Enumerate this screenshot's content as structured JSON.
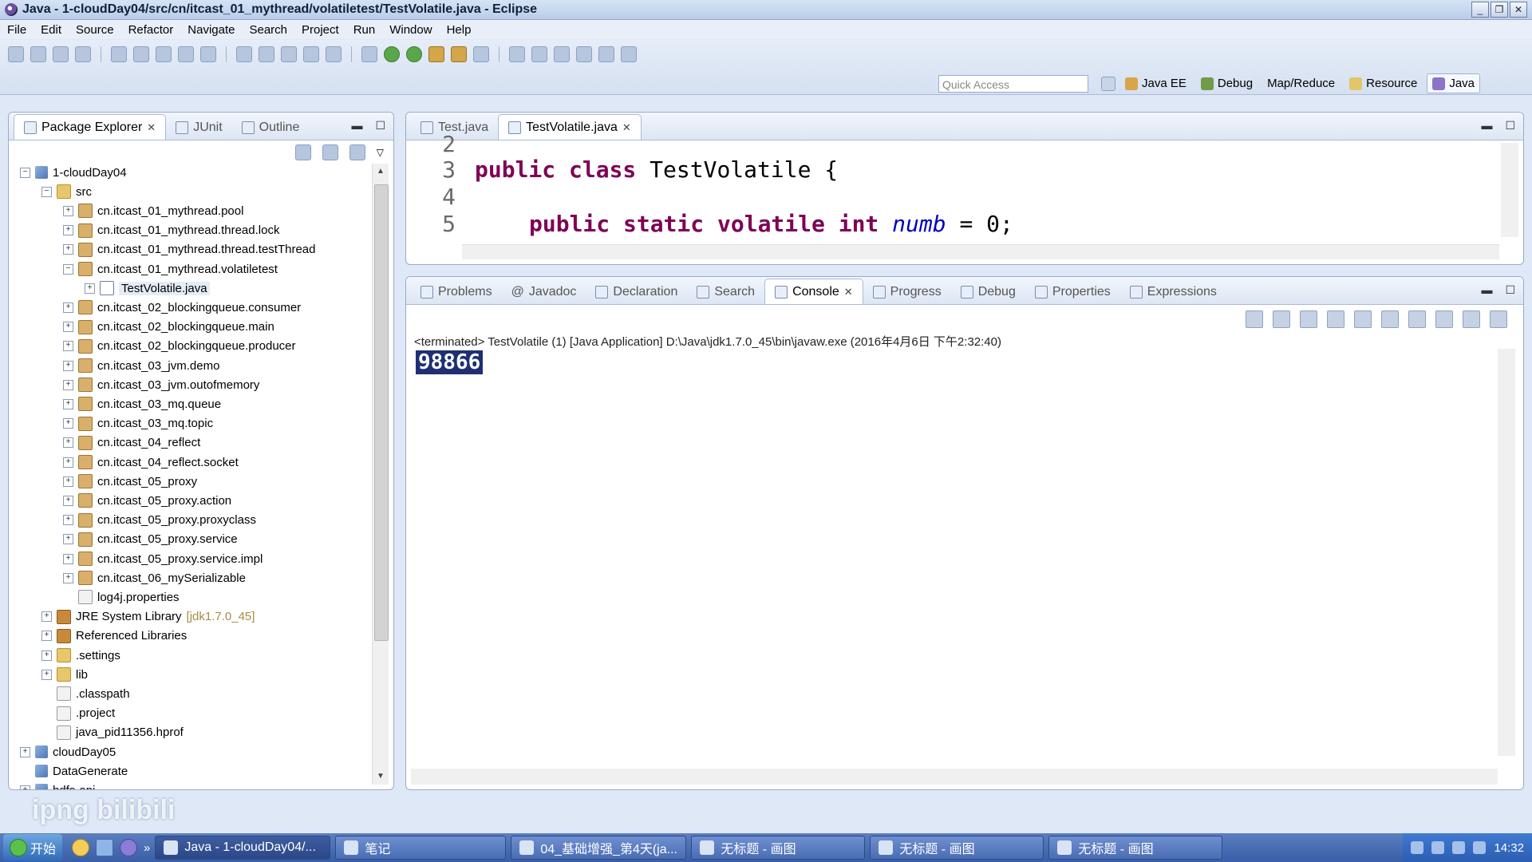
{
  "window": {
    "title": "Java - 1-cloudDay04/src/cn/itcast_01_mythread/volatiletest/TestVolatile.java - Eclipse"
  },
  "menu": [
    "File",
    "Edit",
    "Source",
    "Refactor",
    "Navigate",
    "Search",
    "Project",
    "Run",
    "Window",
    "Help"
  ],
  "quick_access": {
    "placeholder": "Quick Access"
  },
  "perspectives": [
    "Java EE",
    "Debug",
    "Map/Reduce",
    "Resource",
    "Java"
  ],
  "left_tabs": [
    {
      "label": "Package Explorer",
      "closable": true
    },
    {
      "label": "JUnit",
      "closable": false
    },
    {
      "label": "Outline",
      "closable": false
    }
  ],
  "tree": [
    {
      "label": "1-cloudDay04",
      "level": 0,
      "icon": "project-icon",
      "expand": "−"
    },
    {
      "label": "src",
      "level": 1,
      "icon": "folder-icon",
      "expand": "−"
    },
    {
      "label": "cn.itcast_01_mythread.pool",
      "level": 2,
      "icon": "package-icon",
      "expand": "+"
    },
    {
      "label": "cn.itcast_01_mythread.thread.lock",
      "level": 2,
      "icon": "package-icon",
      "expand": "+"
    },
    {
      "label": "cn.itcast_01_mythread.thread.testThread",
      "level": 2,
      "icon": "package-icon",
      "expand": "+"
    },
    {
      "label": "cn.itcast_01_mythread.volatiletest",
      "level": 2,
      "icon": "package-icon",
      "expand": "−"
    },
    {
      "label": "TestVolatile.java",
      "level": 3,
      "icon": "java-file-icon",
      "expand": "+",
      "selected": true
    },
    {
      "label": "cn.itcast_02_blockingqueue.consumer",
      "level": 2,
      "icon": "package-icon",
      "expand": "+"
    },
    {
      "label": "cn.itcast_02_blockingqueue.main",
      "level": 2,
      "icon": "package-icon",
      "expand": "+"
    },
    {
      "label": "cn.itcast_02_blockingqueue.producer",
      "level": 2,
      "icon": "package-icon",
      "expand": "+"
    },
    {
      "label": "cn.itcast_03_jvm.demo",
      "level": 2,
      "icon": "package-icon",
      "expand": "+"
    },
    {
      "label": "cn.itcast_03_jvm.outofmemory",
      "level": 2,
      "icon": "package-icon",
      "expand": "+"
    },
    {
      "label": "cn.itcast_03_mq.queue",
      "level": 2,
      "icon": "package-icon",
      "expand": "+"
    },
    {
      "label": "cn.itcast_03_mq.topic",
      "level": 2,
      "icon": "package-icon",
      "expand": "+"
    },
    {
      "label": "cn.itcast_04_reflect",
      "level": 2,
      "icon": "package-icon",
      "expand": "+"
    },
    {
      "label": "cn.itcast_04_reflect.socket",
      "level": 2,
      "icon": "package-icon",
      "expand": "+"
    },
    {
      "label": "cn.itcast_05_proxy",
      "level": 2,
      "icon": "package-icon",
      "expand": "+"
    },
    {
      "label": "cn.itcast_05_proxy.action",
      "level": 2,
      "icon": "package-icon",
      "expand": "+"
    },
    {
      "label": "cn.itcast_05_proxy.proxyclass",
      "level": 2,
      "icon": "package-icon",
      "expand": "+"
    },
    {
      "label": "cn.itcast_05_proxy.service",
      "level": 2,
      "icon": "package-icon",
      "expand": "+"
    },
    {
      "label": "cn.itcast_05_proxy.service.impl",
      "level": 2,
      "icon": "package-icon",
      "expand": "+"
    },
    {
      "label": "cn.itcast_06_mySerializable",
      "level": 2,
      "icon": "package-icon",
      "expand": "+"
    },
    {
      "label": "log4j.properties",
      "level": 2,
      "icon": "file-icon",
      "expand": ""
    },
    {
      "label": "JRE System Library",
      "decor": "[jdk1.7.0_45]",
      "level": 1,
      "icon": "library-icon",
      "expand": "+"
    },
    {
      "label": "Referenced Libraries",
      "level": 1,
      "icon": "library-icon",
      "expand": "+"
    },
    {
      "label": ".settings",
      "level": 1,
      "icon": "folder-icon",
      "expand": "+"
    },
    {
      "label": "lib",
      "level": 1,
      "icon": "folder-icon",
      "expand": "+"
    },
    {
      "label": ".classpath",
      "level": 1,
      "icon": "xml-file-icon",
      "expand": ""
    },
    {
      "label": ".project",
      "level": 1,
      "icon": "xml-file-icon",
      "expand": ""
    },
    {
      "label": "java_pid11356.hprof",
      "level": 1,
      "icon": "file-icon",
      "expand": ""
    },
    {
      "label": "cloudDay05",
      "level": 0,
      "icon": "project-icon",
      "expand": "+"
    },
    {
      "label": "DataGenerate",
      "level": 0,
      "icon": "project-icon",
      "expand": ""
    },
    {
      "label": "hdfs-api",
      "level": 0,
      "icon": "project-icon",
      "expand": "+"
    }
  ],
  "editor_tabs": [
    {
      "label": "Test.java",
      "active": false
    },
    {
      "label": "TestVolatile.java",
      "active": true
    }
  ],
  "code_lines": [
    {
      "num": "2",
      "text": ""
    },
    {
      "num": "3",
      "kw": "public class",
      "rest": " TestVolatile {"
    },
    {
      "num": "4",
      "text": ""
    },
    {
      "num": "5",
      "kw": "public static volatile int",
      "field": "numb",
      "rest": " = 0;",
      "indent": true
    }
  ],
  "bottom_tabs": [
    {
      "label": "Problems",
      "active": false,
      "closable": false
    },
    {
      "label": "Javadoc",
      "active": false,
      "closable": false
    },
    {
      "label": "Declaration",
      "active": false,
      "closable": false
    },
    {
      "label": "Search",
      "active": false,
      "closable": false
    },
    {
      "label": "Console",
      "active": true,
      "closable": true
    },
    {
      "label": "Progress",
      "active": false,
      "closable": false
    },
    {
      "label": "Debug",
      "active": false,
      "closable": false
    },
    {
      "label": "Properties",
      "active": false,
      "closable": false
    },
    {
      "label": "Expressions",
      "active": false,
      "closable": false
    }
  ],
  "console": {
    "status": "<terminated> TestVolatile (1) [Java Application] D:\\Java\\jdk1.7.0_45\\bin\\javaw.exe (2016年4月6日 下午2:32:40)",
    "output": "98866"
  },
  "watermark": "ipng bilibili",
  "taskbar": {
    "start": "开始",
    "tasks": [
      {
        "label": "Java - 1-cloudDay04/...",
        "active": true
      },
      {
        "label": "笔记",
        "active": false
      },
      {
        "label": "04_基础增强_第4天(ja...",
        "active": false
      },
      {
        "label": "无标题 - 画图",
        "active": false
      },
      {
        "label": "无标题 - 画图",
        "active": false
      },
      {
        "label": "无标题 - 画图",
        "active": false
      }
    ],
    "clock": "14:32"
  }
}
